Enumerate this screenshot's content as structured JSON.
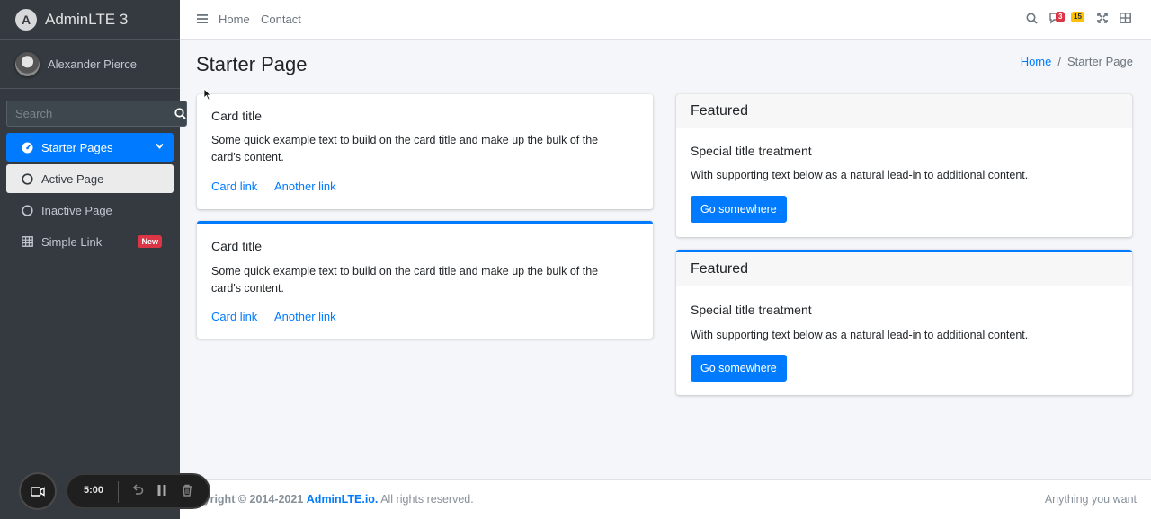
{
  "brand": {
    "logo_letter": "A",
    "name": "AdminLTE 3"
  },
  "user": {
    "name": "Alexander Pierce"
  },
  "sidebar_search": {
    "placeholder": "Search",
    "icon": "search-icon"
  },
  "nav": {
    "items": [
      {
        "label": "Starter Pages",
        "icon": "tachometer-icon",
        "state": "open"
      },
      {
        "label": "Active Page",
        "icon": "circle-icon",
        "state": "active"
      },
      {
        "label": "Inactive Page",
        "icon": "circle-icon",
        "state": "inactive"
      },
      {
        "label": "Simple Link",
        "icon": "table-icon",
        "badge": "New"
      }
    ]
  },
  "topbar": {
    "links": [
      "Home",
      "Contact"
    ],
    "messages_count": "3",
    "notifications_count": "15"
  },
  "page": {
    "title": "Starter Page"
  },
  "breadcrumb": {
    "home": "Home",
    "separator": "/",
    "current": "Starter Page"
  },
  "left_cards": [
    {
      "title": "Card title",
      "text": "Some quick example text to build on the card title and make up the bulk of the card's content.",
      "link1": "Card link",
      "link2": "Another link"
    },
    {
      "title": "Card title",
      "text": "Some quick example text to build on the card title and make up the bulk of the card's content.",
      "link1": "Card link",
      "link2": "Another link"
    }
  ],
  "right_cards": [
    {
      "header": "Featured",
      "title": "Special title treatment",
      "text": "With supporting text below as a natural lead-in to additional content.",
      "button": "Go somewhere"
    },
    {
      "header": "Featured",
      "title": "Special title treatment",
      "text": "With supporting text below as a natural lead-in to additional content.",
      "button": "Go somewhere"
    }
  ],
  "footer": {
    "copyright": "pyright © 2014-2021",
    "brand": "AdminLTE.io.",
    "rights": " All rights reserved.",
    "right_text": "Anything you want"
  },
  "recorder": {
    "time": "5:00"
  },
  "colors": {
    "primary": "#007bff",
    "sidebar": "#343a40",
    "danger": "#dc3545",
    "warning": "#ffc107"
  }
}
